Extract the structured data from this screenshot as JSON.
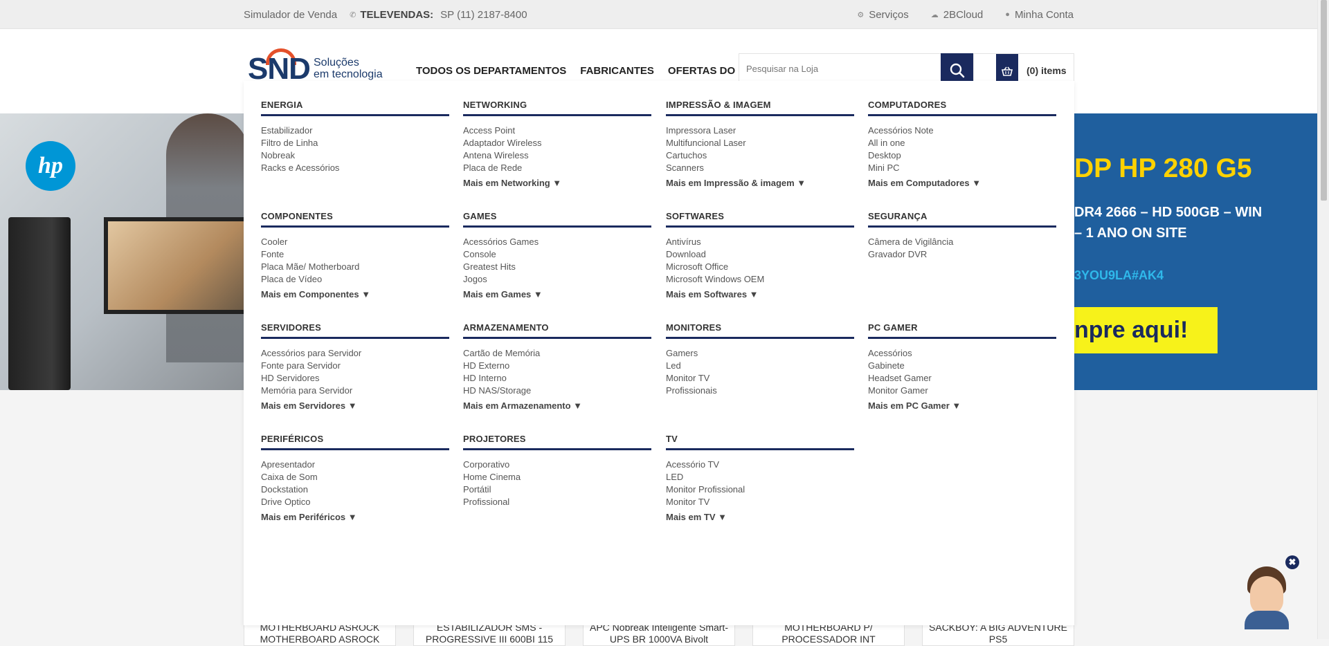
{
  "topbar": {
    "simulator": "Simulador de Venda",
    "phone_label": "TELEVENDAS:",
    "phone_value": "SP (11)  2187-8400",
    "links": [
      {
        "label": "Serviços",
        "icon": "gear-icon"
      },
      {
        "label": "2BCloud",
        "icon": "cloud-icon"
      },
      {
        "label": "Minha Conta",
        "icon": "user-icon"
      }
    ]
  },
  "header": {
    "logo_text": "SND",
    "logo_tagline_1": "Soluções",
    "logo_tagline_2": "em tecnologia",
    "nav": [
      "TODOS OS DEPARTAMENTOS",
      "FABRICANTES",
      "OFERTAS DO DIA"
    ],
    "search_placeholder": "Pesquisar na Loja",
    "cart_count": "(0) items"
  },
  "hero": {
    "brand": "hp",
    "title": "DP HP 280 G5",
    "spec_1": "DR4 2666 – HD 500GB – WIN",
    "spec_2": "– 1 ANO ON SITE",
    "code": "3YOU9LA#AK4",
    "cta": "npre aqui!"
  },
  "mega_menu": [
    {
      "title": "ENERGIA",
      "items": [
        "Estabilizador",
        "Filtro de Linha",
        "Nobreak",
        "Racks e Acessórios"
      ],
      "more": ""
    },
    {
      "title": "NETWORKING",
      "items": [
        "Access Point",
        "Adaptador Wireless",
        "Antena Wireless",
        "Placa de Rede"
      ],
      "more": "Mais em Networking ▼"
    },
    {
      "title": "IMPRESSÃO & IMAGEM",
      "items": [
        "Impressora Laser",
        "Multifuncional Laser",
        "Cartuchos",
        "Scanners"
      ],
      "more": "Mais em Impressão & imagem ▼"
    },
    {
      "title": "COMPUTADORES",
      "items": [
        "Acessórios Note",
        "All in one",
        "Desktop",
        "Mini PC"
      ],
      "more": "Mais em Computadores ▼"
    },
    {
      "title": "COMPONENTES",
      "items": [
        "Cooler",
        "Fonte",
        "Placa Mãe/ Motherboard",
        "Placa de Vídeo"
      ],
      "more": "Mais em Componentes ▼"
    },
    {
      "title": "GAMES",
      "items": [
        "Acessórios Games",
        "Console",
        "Greatest Hits",
        "Jogos"
      ],
      "more": "Mais em Games ▼"
    },
    {
      "title": "SOFTWARES",
      "items": [
        "Antivírus",
        "Download",
        "Microsoft Office",
        "Microsoft Windows OEM"
      ],
      "more": "Mais em Softwares ▼"
    },
    {
      "title": "SEGURANÇA",
      "items": [
        "Câmera de Vigilância",
        "Gravador DVR"
      ],
      "more": ""
    },
    {
      "title": "SERVIDORES",
      "items": [
        "Acessórios para Servidor",
        "Fonte para Servidor",
        "HD Servidores",
        "Memória para Servidor"
      ],
      "more": "Mais em Servidores ▼"
    },
    {
      "title": "ARMAZENAMENTO",
      "items": [
        "Cartão de Memória",
        "HD Externo",
        "HD Interno",
        "HD NAS/Storage"
      ],
      "more": "Mais em Armazenamento ▼"
    },
    {
      "title": "MONITORES",
      "items": [
        "Gamers",
        "Led",
        "Monitor TV",
        "Profissionais"
      ],
      "more": ""
    },
    {
      "title": "PC GAMER",
      "items": [
        "Acessórios",
        "Gabinete",
        "Headset Gamer",
        "Monitor Gamer"
      ],
      "more": "Mais em PC Gamer ▼"
    },
    {
      "title": "PERIFÉRICOS",
      "items": [
        "Apresentador",
        "Caixa de Som",
        "Dockstation",
        "Drive Optico"
      ],
      "more": "Mais em Periféricos ▼"
    },
    {
      "title": "PROJETORES",
      "items": [
        "Corporativo",
        "Home Cinema",
        "Portátil",
        "Profissional"
      ],
      "more": ""
    },
    {
      "title": "TV",
      "items": [
        "Acessório TV",
        "LED",
        "Monitor Profissional",
        "Monitor TV"
      ],
      "more": "Mais em TV ▼"
    }
  ],
  "products": [
    "MOTHERBOARD ASROCK MOTHERBOARD ASROCK",
    "ESTABILIZADOR SMS - PROGRESSIVE III 600BI 115",
    "APC Nobreak Inteligente Smart-UPS BR 1000VA Bivolt",
    "MOTHERBOARD P/ PROCESSADOR INT",
    "SACKBOY: A BIG ADVENTURE PS5"
  ],
  "chatbot": {
    "close_label": "✖"
  }
}
